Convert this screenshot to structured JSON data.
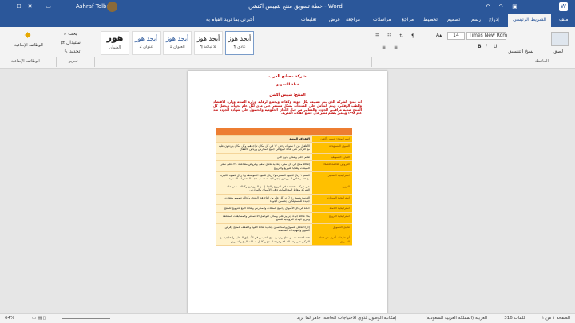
{
  "window": {
    "title": "خطة تسويق منتج شيبس اكتشن  -  Word",
    "user": "Ashraf Tolbani"
  },
  "tabs": [
    "ملف",
    "الشريط الرئيسي",
    "إدراج",
    "رسم",
    "تصميم",
    "تخطيط",
    "مراجع",
    "مراسلات",
    "مراجعة",
    "عرض",
    "تعليمات",
    "أخبرني بما تريد القيام به"
  ],
  "active_tab": "الشريط الرئيسي",
  "ribbon": {
    "clipboard": {
      "paste": "لصق",
      "format_painter": "نسخ التنسيق",
      "group": "الحافظة"
    },
    "font": {
      "name": "Times New Rom",
      "size": "14"
    },
    "styles": [
      {
        "preview": "أبجد هوز",
        "name": "¶ عادي"
      },
      {
        "preview": "أبجد هوز",
        "name": "¶ بلا تباعد"
      },
      {
        "preview": "أبجد هوز",
        "name": "العنوان 1"
      },
      {
        "preview": "أبجد هوز",
        "name": "عنوان 2"
      },
      {
        "preview": "هور",
        "name": "العنوان"
      }
    ],
    "editing": {
      "find": "بحث",
      "replace": "استبدال",
      "select": "تحديد",
      "group": "تحرير"
    },
    "addins": {
      "label": "الوظائف الإضافية",
      "group": "الوظائف الإضافية"
    }
  },
  "document": {
    "company": "شركة مصانع العرب",
    "plan_title": "خطة التسويق",
    "product": "المنتج: شيبس أكشن",
    "intro": "انه منتج الشركة الذي يتم تصنيعه بكل جودة وكفاءة ويخضع لرقابة وزارة الصحة وزارة الاقتصاد والطب الوقائي، ويتم التعامل على المنتجات بشكل مستمر على مدى لكل عام بجهات ويحمل كل المنتج صحية مراقبين للجودة والمعايير من قبل اللجان الحكومية والحصول على شهادة الجودة منذ عام ١٩٩٨ ويتميز بطعم مميز لدى جميع الفئات العمرية.",
    "table_header": [
      "",
      ""
    ],
    "rows": [
      {
        "key": "اسم المنتج: شيبس أكشن",
        "value": "الأهداف البيعية"
      },
      {
        "key": "السوق المستهدفة",
        "value": "الأطفال من ٣ سنوات وحتى ١٢ في كل مكان تواجدهم، وكل مكان يترددون عليه مع التركيز على نقاط البيع في جميع المدارس ورياض الأطفال"
      },
      {
        "key": "العبارة التسويقية",
        "value": "طعم أحلى وصحي بدون قلي"
      },
      {
        "key": "العروض الخاصة للعملاء",
        "value": "إضافة منتج في كل سعر، وتحديد تحدي سعر، وعروض مضاعفة ٢٠٪ على سعر المبيعات وهدايا للتوزيع والترويج"
      },
      {
        "key": "استراتيجية التسعير",
        "value": "السعر ١ ريال للعبوة الصغيرة و٢ ريال للعبوة المتوسطة و٣ ريال للعبوة الكبيرة، مع خصم خاص للموزعين وتجار الجملة حسب حجم المشتريات السنوية"
      },
      {
        "key": "التوزيع",
        "value": "عبر شركة متخصصة في التوزيع والتعامل مع الموزعين وكذلك مستودعات الشركة ونقاط البيع المباشرة في الأسواق والمدارس"
      },
      {
        "key": "استراتيجية المبيعات",
        "value": "التوسع بنسبة ١٠ ٪ في كل عام من إنتاج هذا المنتج، وكذلك تصميم منتجات جديدة للمستهلكين وتحسين الجودة"
      },
      {
        "key": "استراتيجية الحملة",
        "value": "حملة في كل الأسواق وجميع المحلات والمدارس ونقاط البيع للترويج للمنتج"
      },
      {
        "key": "استراتيجية الترويج",
        "value": "بناء علاقة جيدة وتركيز على وسائل التواصل الاجتماعي والمسابقات المختلفة وتوزيع الهدايا الترويجية للمنتج"
      },
      {
        "key": "تحليل التسويق",
        "value": "إجراء تحليل للسوق والمنافسين وتحديد نقاط القوة والضعف للمنتج وفرص السوق والتهديدات المحتملة"
      },
      {
        "key": "أي تعليقات أخرى عن خطة التسويق",
        "value": "هذه الخطة تضمن نجاح وتوسع منتج الشيبس في الأسواق المحلية والخليجية مع التركيز على رضا العملاء وجودة المنتج وتكامل عمليات البيع والتسويق"
      }
    ]
  },
  "status": {
    "page": "الصفحة ١ من ١",
    "words": "316 كلمات",
    "language": "العربية (المملكة العربية السعودية)",
    "accessibility": "إمكانية الوصول لذوي الاحتياجات الخاصة: جاهز لما تريد",
    "zoom": "64%"
  },
  "colors": {
    "accent": "#2b579a",
    "table_header": "#ed7d31",
    "table_key": "#ffc000",
    "table_value": "#fff2cc",
    "heading_red": "#c00000"
  }
}
